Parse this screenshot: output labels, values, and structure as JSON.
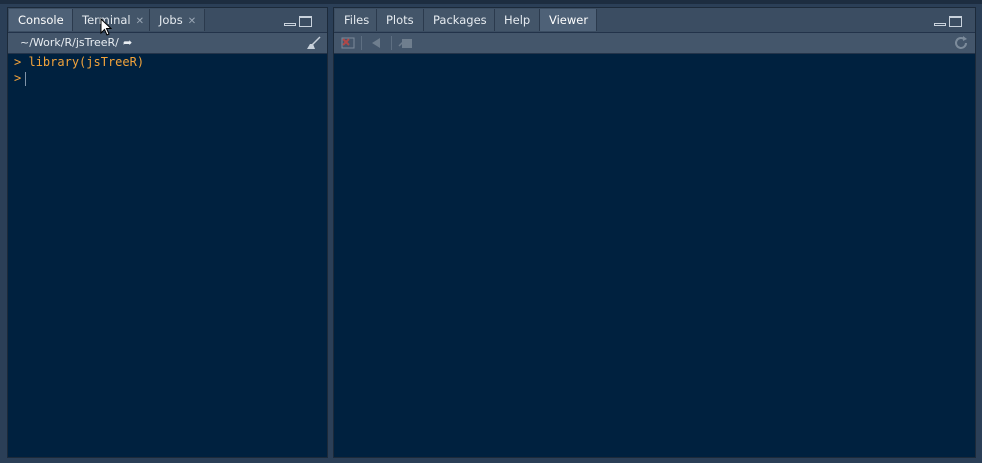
{
  "left_pane": {
    "tabs": [
      {
        "label": "Console",
        "closable": false,
        "active": true
      },
      {
        "label": "Terminal",
        "closable": true,
        "active": false
      },
      {
        "label": "Jobs",
        "closable": true,
        "active": false
      }
    ],
    "path": "~/Work/R/jsTreeR/",
    "console_lines": [
      {
        "prompt": ">",
        "text": "library(jsTreeR)"
      },
      {
        "prompt": ">",
        "text": ""
      }
    ]
  },
  "right_pane": {
    "tabs": [
      {
        "label": "Files",
        "active": false
      },
      {
        "label": "Plots",
        "active": false
      },
      {
        "label": "Packages",
        "active": false
      },
      {
        "label": "Help",
        "active": false
      },
      {
        "label": "Viewer",
        "active": true
      }
    ]
  },
  "icons": {
    "close_tab": "close-icon",
    "minimize": "minimize-icon",
    "maximize": "maximize-icon",
    "go_to_dir": "arrow-right-icon",
    "clear_console": "broom-icon",
    "remove_viewer": "remove-icon",
    "back": "back-arrow-icon",
    "export": "export-icon",
    "refresh": "refresh-icon"
  },
  "colors": {
    "console_bg": "#00213f",
    "prompt": "#f2a33b",
    "pane_bg": "#3a4c61"
  }
}
